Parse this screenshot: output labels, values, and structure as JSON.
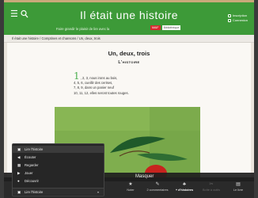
{
  "header": {
    "title": "Il était une histoire",
    "tagline": "Faire grandir le plaisir de lire avec la",
    "badge_red": "MAIF",
    "badge_white": "Bibliothèque",
    "links": [
      "Inscription",
      "Connexion"
    ],
    "color": "#3d9a38"
  },
  "breadcrumb": "Il était une histoire / Comptines et chansons / Un, deux, trois",
  "page": {
    "heading": "Un, deux, trois",
    "subheading": "L'histoire"
  },
  "poem": {
    "dropcap": "1",
    "lines": [
      ", 2, 3, nous irons au bois,",
      "4, 5, 6, cueillir des cerises,",
      "7, 8, 9, dans un panier neuf",
      "10, 11, 12, elles seront toutes rouges."
    ]
  },
  "masquer": "Masquer",
  "dropdown": {
    "items": [
      {
        "icon": "book-icon",
        "label": "Lire l'histoire"
      },
      {
        "icon": "speaker-icon",
        "label": "Écouter"
      },
      {
        "icon": "film-icon",
        "label": "Regarder"
      },
      {
        "icon": "play-icon",
        "label": "Jouer"
      },
      {
        "icon": "person-icon",
        "label": "Découvrir"
      }
    ],
    "current": {
      "label": "Lire l'histoire",
      "trail": "▾"
    }
  },
  "toolbar": {
    "items": [
      {
        "icon": "star-icon",
        "label": "Noter"
      },
      {
        "icon": "comment-icon",
        "label": "2 commentaires"
      },
      {
        "icon": "share-icon",
        "label": "+ d'histoires"
      },
      {
        "icon": "toolbox-icon",
        "label": "Boîte à outils"
      },
      {
        "icon": "document-icon",
        "label": "Le livre"
      }
    ]
  }
}
